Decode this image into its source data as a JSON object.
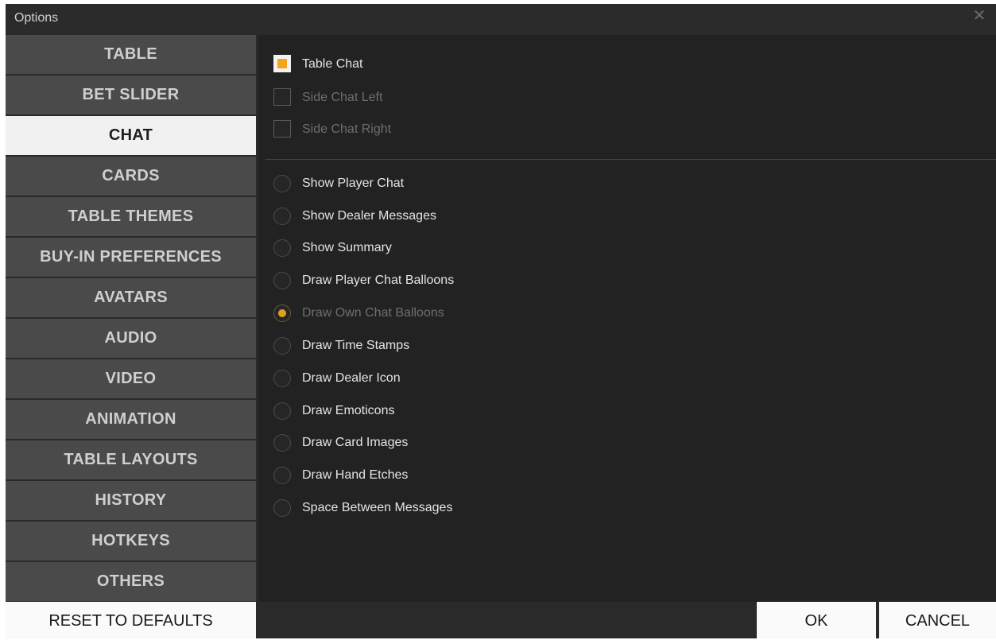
{
  "window": {
    "title": "Options"
  },
  "sidebar": {
    "items": [
      {
        "label": "TABLE"
      },
      {
        "label": "BET SLIDER"
      },
      {
        "label": "CHAT"
      },
      {
        "label": "CARDS"
      },
      {
        "label": "TABLE THEMES"
      },
      {
        "label": "BUY-IN PREFERENCES"
      },
      {
        "label": "AVATARS"
      },
      {
        "label": "AUDIO"
      },
      {
        "label": "VIDEO"
      },
      {
        "label": "ANIMATION"
      },
      {
        "label": "TABLE LAYOUTS"
      },
      {
        "label": "HISTORY"
      },
      {
        "label": "HOTKEYS"
      },
      {
        "label": "OTHERS"
      }
    ],
    "active": "CHAT"
  },
  "chat": {
    "checkboxes": [
      {
        "label": "Table Chat",
        "checked": true,
        "enabled": true
      },
      {
        "label": "Side Chat Left",
        "checked": false,
        "enabled": false
      },
      {
        "label": "Side Chat Right",
        "checked": false,
        "enabled": false
      }
    ],
    "options": [
      {
        "label": "Show Player Chat",
        "selected": false,
        "enabled": true
      },
      {
        "label": "Show Dealer Messages",
        "selected": false,
        "enabled": true
      },
      {
        "label": "Show Summary",
        "selected": false,
        "enabled": true
      },
      {
        "label": "Draw Player Chat Balloons",
        "selected": false,
        "enabled": true
      },
      {
        "label": "Draw Own Chat Balloons",
        "selected": true,
        "enabled": false
      },
      {
        "label": "Draw Time Stamps",
        "selected": false,
        "enabled": true
      },
      {
        "label": "Draw Dealer Icon",
        "selected": false,
        "enabled": true
      },
      {
        "label": "Draw Emoticons",
        "selected": false,
        "enabled": true
      },
      {
        "label": "Draw Card Images",
        "selected": false,
        "enabled": true
      },
      {
        "label": "Draw Hand Etches",
        "selected": false,
        "enabled": true
      },
      {
        "label": "Space Between Messages",
        "selected": false,
        "enabled": true
      }
    ]
  },
  "footer": {
    "reset_label": "RESET TO DEFAULTS",
    "ok_label": "OK",
    "cancel_label": "CANCEL"
  },
  "colors": {
    "accent": "#f5a31a",
    "radio_accent": "#e0a021",
    "background": "#222222",
    "nav_background": "#4a4a4a",
    "nav_active": "#f1f1f1"
  }
}
